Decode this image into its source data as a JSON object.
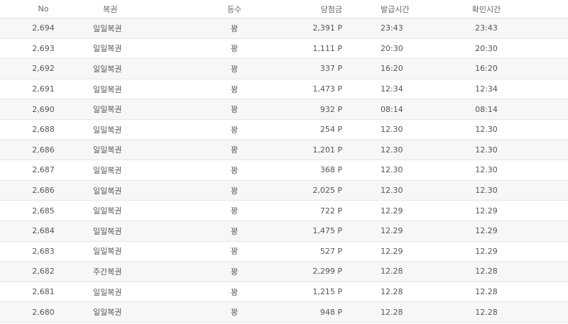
{
  "columns": {
    "no": "No",
    "ticket": "복권",
    "rank": "등수",
    "prize": "당첨금",
    "issued": "발급시간",
    "checked": "확인시간"
  },
  "rows": [
    {
      "no": "2,694",
      "ticket": "일일복권",
      "rank": "꽝",
      "prize": "2,391 P",
      "issued": "23:43",
      "checked": "23:43"
    },
    {
      "no": "2,693",
      "ticket": "일일복권",
      "rank": "꽝",
      "prize": "1,111 P",
      "issued": "20:30",
      "checked": "20:30"
    },
    {
      "no": "2,692",
      "ticket": "일일복권",
      "rank": "꽝",
      "prize": "337 P",
      "issued": "16:20",
      "checked": "16:20"
    },
    {
      "no": "2,691",
      "ticket": "일일복권",
      "rank": "꽝",
      "prize": "1,473 P",
      "issued": "12:34",
      "checked": "12:34"
    },
    {
      "no": "2,690",
      "ticket": "일일복권",
      "rank": "꽝",
      "prize": "932 P",
      "issued": "08:14",
      "checked": "08:14"
    },
    {
      "no": "2,688",
      "ticket": "일일복권",
      "rank": "꽝",
      "prize": "254 P",
      "issued": "12.30",
      "checked": "12.30"
    },
    {
      "no": "2,686",
      "ticket": "일일복권",
      "rank": "꽝",
      "prize": "1,201 P",
      "issued": "12.30",
      "checked": "12.30"
    },
    {
      "no": "2,687",
      "ticket": "일일복권",
      "rank": "꽝",
      "prize": "368 P",
      "issued": "12.30",
      "checked": "12.30"
    },
    {
      "no": "2,686",
      "ticket": "일일복권",
      "rank": "꽝",
      "prize": "2,025 P",
      "issued": "12.30",
      "checked": "12.30"
    },
    {
      "no": "2,685",
      "ticket": "일일복권",
      "rank": "꽝",
      "prize": "722 P",
      "issued": "12.29",
      "checked": "12.29"
    },
    {
      "no": "2,684",
      "ticket": "일일복권",
      "rank": "꽝",
      "prize": "1,475 P",
      "issued": "12.29",
      "checked": "12.29"
    },
    {
      "no": "2,683",
      "ticket": "일일복권",
      "rank": "꽝",
      "prize": "527 P",
      "issued": "12.29",
      "checked": "12.29"
    },
    {
      "no": "2,682",
      "ticket": "주간복권",
      "rank": "꽝",
      "prize": "2,299 P",
      "issued": "12.28",
      "checked": "12.28"
    },
    {
      "no": "2,681",
      "ticket": "일일복권",
      "rank": "꽝",
      "prize": "1,215 P",
      "issued": "12.28",
      "checked": "12.28"
    },
    {
      "no": "2,680",
      "ticket": "일일복권",
      "rank": "꽝",
      "prize": "948 P",
      "issued": "12.28",
      "checked": "12.28"
    }
  ]
}
